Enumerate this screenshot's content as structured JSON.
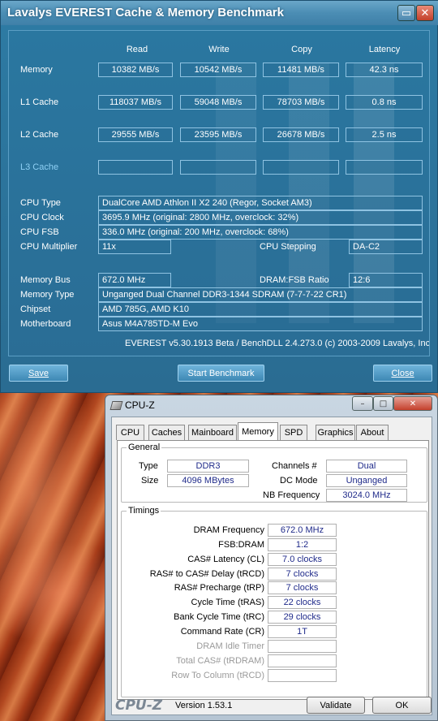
{
  "everest": {
    "title": "Lavalys EVEREST Cache & Memory Benchmark",
    "columns": [
      "Read",
      "Write",
      "Copy",
      "Latency"
    ],
    "rows": [
      {
        "label": "Memory",
        "values": [
          "10382 MB/s",
          "10542 MB/s",
          "11481 MB/s",
          "42.3 ns"
        ]
      },
      {
        "label": "L1 Cache",
        "values": [
          "118037 MB/s",
          "59048 MB/s",
          "78703 MB/s",
          "0.8 ns"
        ]
      },
      {
        "label": "L2 Cache",
        "values": [
          "29555 MB/s",
          "23595 MB/s",
          "26678 MB/s",
          "2.5 ns"
        ]
      },
      {
        "label": "L3 Cache",
        "values": [
          "",
          "",
          "",
          ""
        ]
      }
    ],
    "cpu": {
      "type_label": "CPU Type",
      "type": "DualCore AMD Athlon II X2 240  (Regor, Socket AM3)",
      "clock_label": "CPU Clock",
      "clock": "3695.9 MHz  (original: 2800 MHz, overclock: 32%)",
      "fsb_label": "CPU FSB",
      "fsb": "336.0 MHz  (original: 200 MHz, overclock: 68%)",
      "multiplier_label": "CPU Multiplier",
      "multiplier": "11x",
      "stepping_label": "CPU Stepping",
      "stepping": "DA-C2"
    },
    "memory": {
      "bus_label": "Memory Bus",
      "bus": "672.0 MHz",
      "ratio_label": "DRAM:FSB Ratio",
      "ratio": "12:6",
      "type_label": "Memory Type",
      "type": "Unganged Dual Channel DDR3-1344 SDRAM  (7-7-7-22 CR1)",
      "chipset_label": "Chipset",
      "chipset": "AMD 785G, AMD K10",
      "motherboard_label": "Motherboard",
      "motherboard": "Asus M4A785TD-M Evo"
    },
    "footer": "EVEREST v5.30.1913 Beta / BenchDLL 2.4.273.0  (c) 2003-2009 Lavalys, Inc.",
    "buttons": {
      "save": "Save",
      "start": "Start Benchmark",
      "close": "Close"
    }
  },
  "cpuz": {
    "title": "CPU-Z",
    "tabs": [
      "CPU",
      "Caches",
      "Mainboard",
      "Memory",
      "SPD",
      "Graphics",
      "About"
    ],
    "active_tab": "Memory",
    "general": {
      "legend": "General",
      "type_label": "Type",
      "type": "DDR3",
      "size_label": "Size",
      "size": "4096 MBytes",
      "channels_label": "Channels #",
      "channels": "Dual",
      "dcmode_label": "DC Mode",
      "dcmode": "Unganged",
      "nbfreq_label": "NB Frequency",
      "nbfreq": "3024.0 MHz"
    },
    "timings": {
      "legend": "Timings",
      "items": [
        {
          "label": "DRAM Frequency",
          "value": "672.0 MHz"
        },
        {
          "label": "FSB:DRAM",
          "value": "1:2"
        },
        {
          "label": "CAS# Latency (CL)",
          "value": "7.0 clocks"
        },
        {
          "label": "RAS# to CAS# Delay (tRCD)",
          "value": "7 clocks"
        },
        {
          "label": "RAS# Precharge (tRP)",
          "value": "7 clocks"
        },
        {
          "label": "Cycle Time (tRAS)",
          "value": "22 clocks"
        },
        {
          "label": "Bank Cycle Time (tRC)",
          "value": "29 clocks"
        },
        {
          "label": "Command Rate (CR)",
          "value": "1T"
        },
        {
          "label": "DRAM Idle Timer",
          "value": ""
        },
        {
          "label": "Total CAS# (tRDRAM)",
          "value": ""
        },
        {
          "label": "Row To Column (tRCD)",
          "value": ""
        }
      ]
    },
    "brand": "CPU-Z",
    "version": "Version 1.53.1",
    "buttons": {
      "validate": "Validate",
      "ok": "OK"
    }
  }
}
